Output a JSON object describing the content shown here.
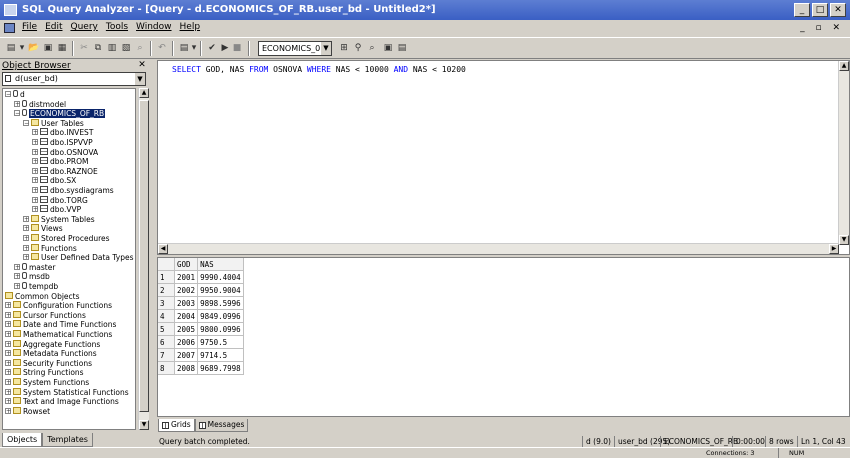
{
  "window": {
    "title": "SQL Query Analyzer - [Query - d.ECONOMICS_OF_RB.user_bd - Untitled2*]",
    "minimize_glyph": "_",
    "restore_glyph": "□",
    "close_glyph": "✕"
  },
  "menu": {
    "items": [
      "File",
      "Edit",
      "Query",
      "Tools",
      "Window",
      "Help"
    ],
    "mdi_controls": "_ ▫ ✕"
  },
  "toolbar": {
    "database": "ECONOMICS_0"
  },
  "object_browser": {
    "title": "Object Browser",
    "close_glyph": "✕",
    "server": "d(user_bd)",
    "tabs": [
      "Objects",
      "Templates"
    ],
    "tree": [
      {
        "label": "d",
        "indent": 0,
        "icon": "server",
        "pm": "−"
      },
      {
        "label": "distmodel",
        "indent": 1,
        "icon": "db",
        "pm": "+"
      },
      {
        "label": "ECONOMICS_OF_RB",
        "indent": 1,
        "icon": "db",
        "pm": "−",
        "selected": true
      },
      {
        "label": "User Tables",
        "indent": 2,
        "icon": "folder",
        "pm": "−"
      },
      {
        "label": "dbo.INVEST",
        "indent": 3,
        "icon": "table",
        "pm": "+"
      },
      {
        "label": "dbo.ISPVVP",
        "indent": 3,
        "icon": "table",
        "pm": "+"
      },
      {
        "label": "dbo.OSNOVA",
        "indent": 3,
        "icon": "table",
        "pm": "+"
      },
      {
        "label": "dbo.PROM",
        "indent": 3,
        "icon": "table",
        "pm": "+"
      },
      {
        "label": "dbo.RAZNOE",
        "indent": 3,
        "icon": "table",
        "pm": "+"
      },
      {
        "label": "dbo.SX",
        "indent": 3,
        "icon": "table",
        "pm": "+"
      },
      {
        "label": "dbo.sysdiagrams",
        "indent": 3,
        "icon": "table",
        "pm": "+"
      },
      {
        "label": "dbo.TORG",
        "indent": 3,
        "icon": "table",
        "pm": "+"
      },
      {
        "label": "dbo.VVP",
        "indent": 3,
        "icon": "table",
        "pm": "+"
      },
      {
        "label": "System Tables",
        "indent": 2,
        "icon": "folder",
        "pm": "+"
      },
      {
        "label": "Views",
        "indent": 2,
        "icon": "folder",
        "pm": "+"
      },
      {
        "label": "Stored Procedures",
        "indent": 2,
        "icon": "folder",
        "pm": "+"
      },
      {
        "label": "Functions",
        "indent": 2,
        "icon": "folder",
        "pm": "+"
      },
      {
        "label": "User Defined Data Types",
        "indent": 2,
        "icon": "folder",
        "pm": "+"
      },
      {
        "label": "master",
        "indent": 1,
        "icon": "db",
        "pm": "+"
      },
      {
        "label": "msdb",
        "indent": 1,
        "icon": "db",
        "pm": "+"
      },
      {
        "label": "tempdb",
        "indent": 1,
        "icon": "db",
        "pm": "+"
      },
      {
        "label": "Common Objects",
        "indent": 0,
        "icon": "folder",
        "pm": ""
      },
      {
        "label": "Configuration Functions",
        "indent": 0,
        "icon": "folder",
        "pm": "+"
      },
      {
        "label": "Cursor Functions",
        "indent": 0,
        "icon": "folder",
        "pm": "+"
      },
      {
        "label": "Date and Time Functions",
        "indent": 0,
        "icon": "folder",
        "pm": "+"
      },
      {
        "label": "Mathematical Functions",
        "indent": 0,
        "icon": "folder",
        "pm": "+"
      },
      {
        "label": "Aggregate Functions",
        "indent": 0,
        "icon": "folder",
        "pm": "+"
      },
      {
        "label": "Metadata Functions",
        "indent": 0,
        "icon": "folder",
        "pm": "+"
      },
      {
        "label": "Security Functions",
        "indent": 0,
        "icon": "folder",
        "pm": "+"
      },
      {
        "label": "String Functions",
        "indent": 0,
        "icon": "folder",
        "pm": "+"
      },
      {
        "label": "System Functions",
        "indent": 0,
        "icon": "folder",
        "pm": "+"
      },
      {
        "label": "System Statistical Functions",
        "indent": 0,
        "icon": "folder",
        "pm": "+"
      },
      {
        "label": "Text and Image Functions",
        "indent": 0,
        "icon": "folder",
        "pm": "+"
      },
      {
        "label": "Rowset",
        "indent": 0,
        "icon": "folder",
        "pm": "+"
      }
    ]
  },
  "editor": {
    "query_parts": [
      {
        "t": "SELECT",
        "k": true
      },
      {
        "t": " GOD, NAS ",
        "k": false
      },
      {
        "t": "FROM",
        "k": true
      },
      {
        "t": " OSNOVA ",
        "k": false
      },
      {
        "t": "WHERE",
        "k": true
      },
      {
        "t": " NAS < 10000 ",
        "k": false
      },
      {
        "t": "AND",
        "k": true
      },
      {
        "t": " NAS < 10200",
        "k": false
      }
    ]
  },
  "results": {
    "columns": [
      "GOD",
      "NAS"
    ],
    "rows": [
      [
        "1",
        "2001",
        "9990.4004"
      ],
      [
        "2",
        "2002",
        "9950.9004"
      ],
      [
        "3",
        "2003",
        "9898.5996"
      ],
      [
        "4",
        "2004",
        "9849.0996"
      ],
      [
        "5",
        "2005",
        "9800.0996"
      ],
      [
        "6",
        "2006",
        "9750.5"
      ],
      [
        "7",
        "2007",
        "9714.5"
      ],
      [
        "8",
        "2008",
        "9689.7998"
      ]
    ],
    "tabs": [
      "Grids",
      "Messages"
    ]
  },
  "status": {
    "message": "Query batch completed.",
    "server": "d (9.0)",
    "user": "user_bd (295)",
    "database": "ECONOMICS_OF_RB",
    "time": "0:00:00",
    "rows": "8 rows",
    "position": "Ln 1, Col 43",
    "connections": "Connections: 3",
    "num": "NUM"
  },
  "colors": {
    "titlebar": "#3a5fc4",
    "selection": "#0a246a",
    "keyword": "#0000ff"
  }
}
